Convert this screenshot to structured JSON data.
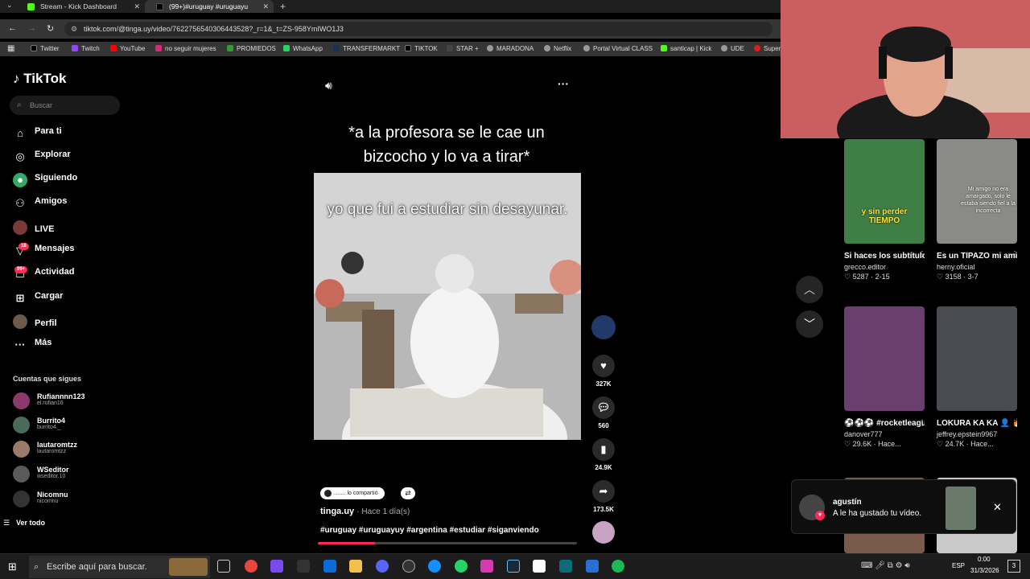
{
  "browser": {
    "tabs": [
      {
        "title": "Stream - Kick Dashboard",
        "active": false
      },
      {
        "title": "(99+)#uruguay #uruguayu",
        "active": true
      }
    ],
    "url": "tiktok.com/@tinga.uy/video/7622756540306443528?_r=1&_t=ZS-958YmIWO1J3",
    "bookmarks": [
      "Twitter",
      "Twitch",
      "YouTube",
      "no seguir mujeres",
      "PROMIEDOS",
      "WhatsApp",
      "TRANSFERMARKT",
      "TIKTOK",
      "STAR +",
      "MARADONA",
      "Netflix",
      "Portal Virtual CLASS",
      "santicap | Kick",
      "UDE",
      "Super"
    ]
  },
  "sidebar": {
    "logo": "TikTok",
    "search_placeholder": "Buscar",
    "nav": [
      {
        "label": "Para ti",
        "icon": "home-icon"
      },
      {
        "label": "Explorar",
        "icon": "compass-icon"
      },
      {
        "label": "Siguiendo",
        "icon": "following-icon"
      },
      {
        "label": "Amigos",
        "icon": "friends-icon"
      },
      {
        "label": "LIVE",
        "icon": "live-icon"
      },
      {
        "label": "Mensajes",
        "icon": "messages-icon"
      },
      {
        "label": "Actividad",
        "icon": "activity-icon"
      },
      {
        "label": "Cargar",
        "icon": "upload-icon"
      },
      {
        "label": "Perfil",
        "icon": "profile-icon"
      },
      {
        "label": "Más",
        "icon": "more-icon"
      }
    ],
    "badges": {
      "mensajes": "18",
      "actividad": "99+"
    },
    "following_title": "Cuentas que sigues",
    "following": [
      {
        "name": "Rufiannnn123",
        "handle": "el.rufian16"
      },
      {
        "name": "Burrito4",
        "handle": "burrito4._"
      },
      {
        "name": "lautaromtzz",
        "handle": "lautaromtzz"
      },
      {
        "name": "WSeditor",
        "handle": "wseditor.10"
      },
      {
        "name": "Nicomnu",
        "handle": "nicomnu"
      }
    ],
    "see_all": "Ver todo"
  },
  "video": {
    "caption": "*a la profesora se le cae un bizcocho y lo va a tirar*",
    "overlay_text": "yo que fui a estudiar sin desayunar.",
    "author": "tinga.uy",
    "time": "· Hace 1 día(s)",
    "hashtags": "#uruguay #uruguayuy #argentina #estudiar  #siganviendo",
    "shared_label": "........ lo compartió",
    "progress_pct": 22,
    "likes": "327K",
    "comments": "560",
    "saves": "24.9K",
    "shares": "173.5K"
  },
  "related": [
    {
      "title": "Si haces los subtítulos así en...",
      "user": "grecco.editor",
      "stats": "♡ 5287 · 2-15",
      "thumb_text": "y sin perder TIEMPO"
    },
    {
      "title": "Es un TIPAZO mi amigo 😂 🙏 ...",
      "user": "herny.oficial",
      "stats": "♡ 3158 · 3-7",
      "thumb_text": "Mi amigo no era amargado, solo le estaba siendo fiel a la incorrecta"
    },
    {
      "title": "⚽⚽⚽ #rocketleague...",
      "user": "danover777",
      "stats": "♡ 29.6K · Hace...",
      "thumb_text": ""
    },
    {
      "title": "LOKURA KA KA 👤 🔥 #humor #fyp...",
      "user": "jeffrey.epstein9967",
      "stats": "♡ 24.7K · Hace...",
      "thumb_text": ""
    }
  ],
  "notification": {
    "user": "agustín",
    "message": "A le ha gustado tu vídeo."
  },
  "taskbar": {
    "search_placeholder": "Escribe aquí para buscar.",
    "lang": "ESP",
    "time": "0:00",
    "date": "31/3/2026",
    "notif_count": "3"
  },
  "colors": {
    "accent": "#fe2c55",
    "bg": "#000000"
  }
}
